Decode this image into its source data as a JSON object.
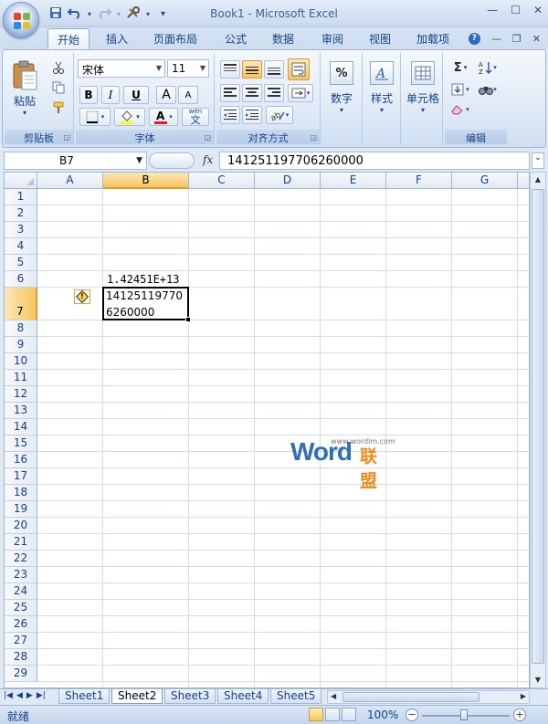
{
  "window": {
    "title": "Book1 - Microsoft Excel",
    "minimize": "—",
    "maximize": "☐",
    "close": "✕"
  },
  "qat": {
    "save_icon": "save-icon",
    "undo_icon": "undo-icon",
    "redo_icon": "redo-icon",
    "tool_icon": "tool-icon",
    "customize": "▾"
  },
  "tabs": [
    {
      "label": "开始",
      "active": true
    },
    {
      "label": "插入"
    },
    {
      "label": "页面布局"
    },
    {
      "label": "公式"
    },
    {
      "label": "数据"
    },
    {
      "label": "审阅"
    },
    {
      "label": "视图"
    },
    {
      "label": "加载项"
    }
  ],
  "ribbon": {
    "clipboard": {
      "paste": "粘贴",
      "label": "剪贴板"
    },
    "font": {
      "name": "宋体",
      "size": "11",
      "bold": "B",
      "italic": "I",
      "underline": "U",
      "grow": "A",
      "shrink": "A",
      "label": "字体",
      "phonetic": "wén"
    },
    "alignment": {
      "label": "对齐方式"
    },
    "number": {
      "label": "数字",
      "symbol": "%"
    },
    "styles": {
      "label": "样式"
    },
    "cells": {
      "label": "单元格"
    },
    "editing": {
      "label": "编辑",
      "sum": "Σ"
    }
  },
  "formula_bar": {
    "name_box": "B7",
    "fx": "fx",
    "value": "141251197706260000"
  },
  "grid": {
    "columns": [
      "A",
      "B",
      "C",
      "D",
      "E",
      "F",
      "G"
    ],
    "selected_column": "B",
    "rows": [
      "1",
      "2",
      "3",
      "4",
      "5",
      "6",
      "7",
      "8",
      "9",
      "10",
      "11",
      "12",
      "13",
      "14",
      "15",
      "16",
      "17",
      "18",
      "19",
      "20",
      "21",
      "22",
      "23",
      "24",
      "25",
      "26",
      "27",
      "28",
      "29"
    ],
    "selected_row": "7",
    "b6": "1.42451E+13",
    "b7_line1": "14125119770",
    "b7_line2": "6260000",
    "error_indicator": "!"
  },
  "watermark": {
    "url": "www.wordlm.com",
    "word": "Word",
    "cn": "联盟"
  },
  "sheets": [
    {
      "label": "Sheet1"
    },
    {
      "label": "Sheet2",
      "active": true
    },
    {
      "label": "Sheet3"
    },
    {
      "label": "Sheet4"
    },
    {
      "label": "Sheet5"
    }
  ],
  "status": {
    "ready": "就绪",
    "zoom": "100%",
    "zoom_minus": "−",
    "zoom_plus": "+"
  }
}
